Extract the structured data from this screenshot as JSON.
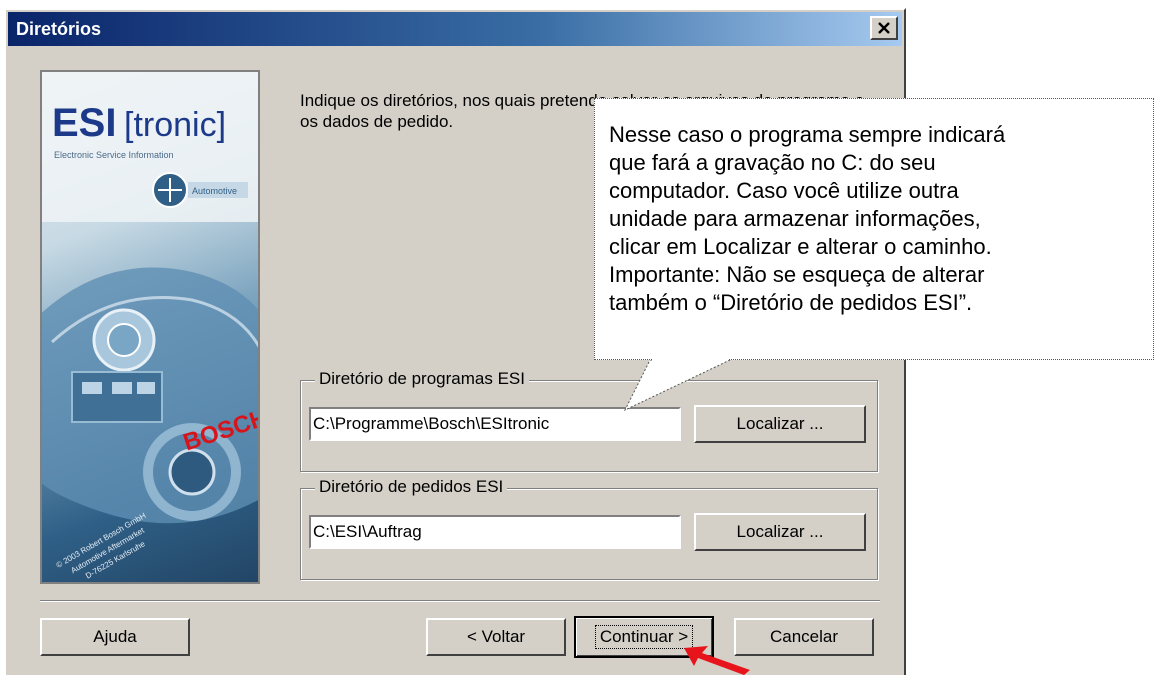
{
  "window": {
    "title": "Diretórios"
  },
  "banner": {
    "product_bold": "ESI",
    "product_light": "[tronic]",
    "subtitle": "Electronic Service Information",
    "badge": "Automotive",
    "brand": "BOSCH",
    "copyright_lines": [
      "© 2003 Robert Bosch GmbH",
      "Automotive Aftermarket",
      "D-76225 Karlsruhe"
    ]
  },
  "instruction": "Indique os diretórios, nos quais pretende salvar os arquivos de programa e os dados de pedido.",
  "program_dir": {
    "label": "Diretório de programas ESI",
    "value": "C:\\Programme\\Bosch\\ESItronic",
    "button": "Localizar ..."
  },
  "orders_dir": {
    "label": "Diretório de pedidos ESI",
    "value": "C:\\ESI\\Auftrag",
    "button": "Localizar ..."
  },
  "buttons": {
    "help": "Ajuda",
    "back": "< Voltar",
    "next": "Continuar >",
    "cancel": "Cancelar"
  },
  "callout": {
    "lines": [
      "Nesse caso o programa sempre indicará",
      "que fará a gravação no C: do seu",
      "computador. Caso você utilize outra",
      "unidade para armazenar informações,",
      "clicar em Localizar e alterar o caminho.",
      "Importante: Não se esqueça de alterar",
      "também o “Diretório de pedidos ESI”."
    ]
  },
  "colors": {
    "titlebar_start": "#0a246a",
    "dialog_face": "#d4d0c8",
    "arrow": "#e8141b",
    "bosch_red": "#d8141b"
  }
}
